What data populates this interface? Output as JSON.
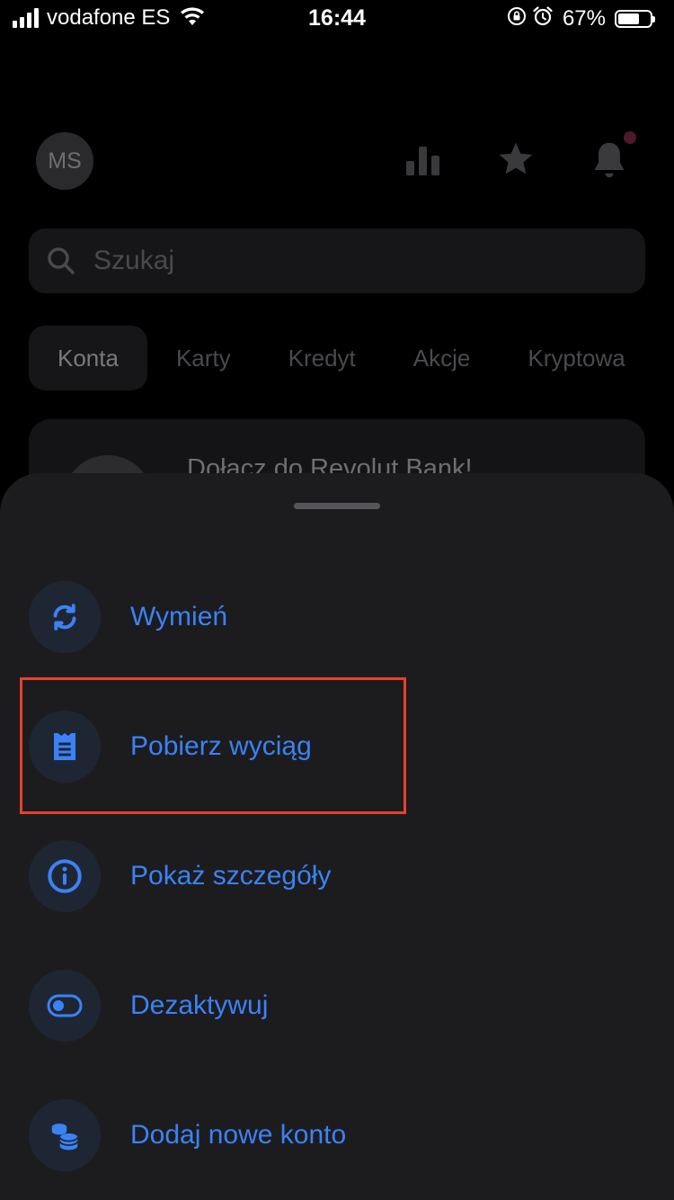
{
  "status_bar": {
    "carrier": "vodafone ES",
    "time": "16:44",
    "battery_percent": "67%",
    "battery_level": 0.67,
    "icons": [
      "signal-icon",
      "wifi-icon",
      "orientation-lock-icon",
      "alarm-icon",
      "battery-icon"
    ]
  },
  "background": {
    "avatar_initials": "MS",
    "header_icons": [
      "bar-chart-icon",
      "star-icon",
      "bell-icon"
    ],
    "search": {
      "placeholder": "Szukaj"
    },
    "tabs": [
      "Konta",
      "Karty",
      "Kredyt",
      "Akcje",
      "Kryptowa"
    ],
    "active_tab": "Konta",
    "card_text": "Dołącz do Revolut Bank!"
  },
  "sheet": {
    "actions": [
      {
        "label": "Wymień",
        "icon": "exchange-icon"
      },
      {
        "label": "Pobierz wyciąg",
        "icon": "statement-icon"
      },
      {
        "label": "Pokaż szczegóły",
        "icon": "info-icon"
      },
      {
        "label": "Dezaktywuj",
        "icon": "toggle-icon"
      },
      {
        "label": "Dodaj nowe konto",
        "icon": "coins-icon"
      }
    ]
  },
  "colors": {
    "accent": "#3b82f6",
    "highlight": "#e8402b",
    "sheet_bg": "#1c1c1e",
    "icon_circle_bg": "#1f2633"
  }
}
